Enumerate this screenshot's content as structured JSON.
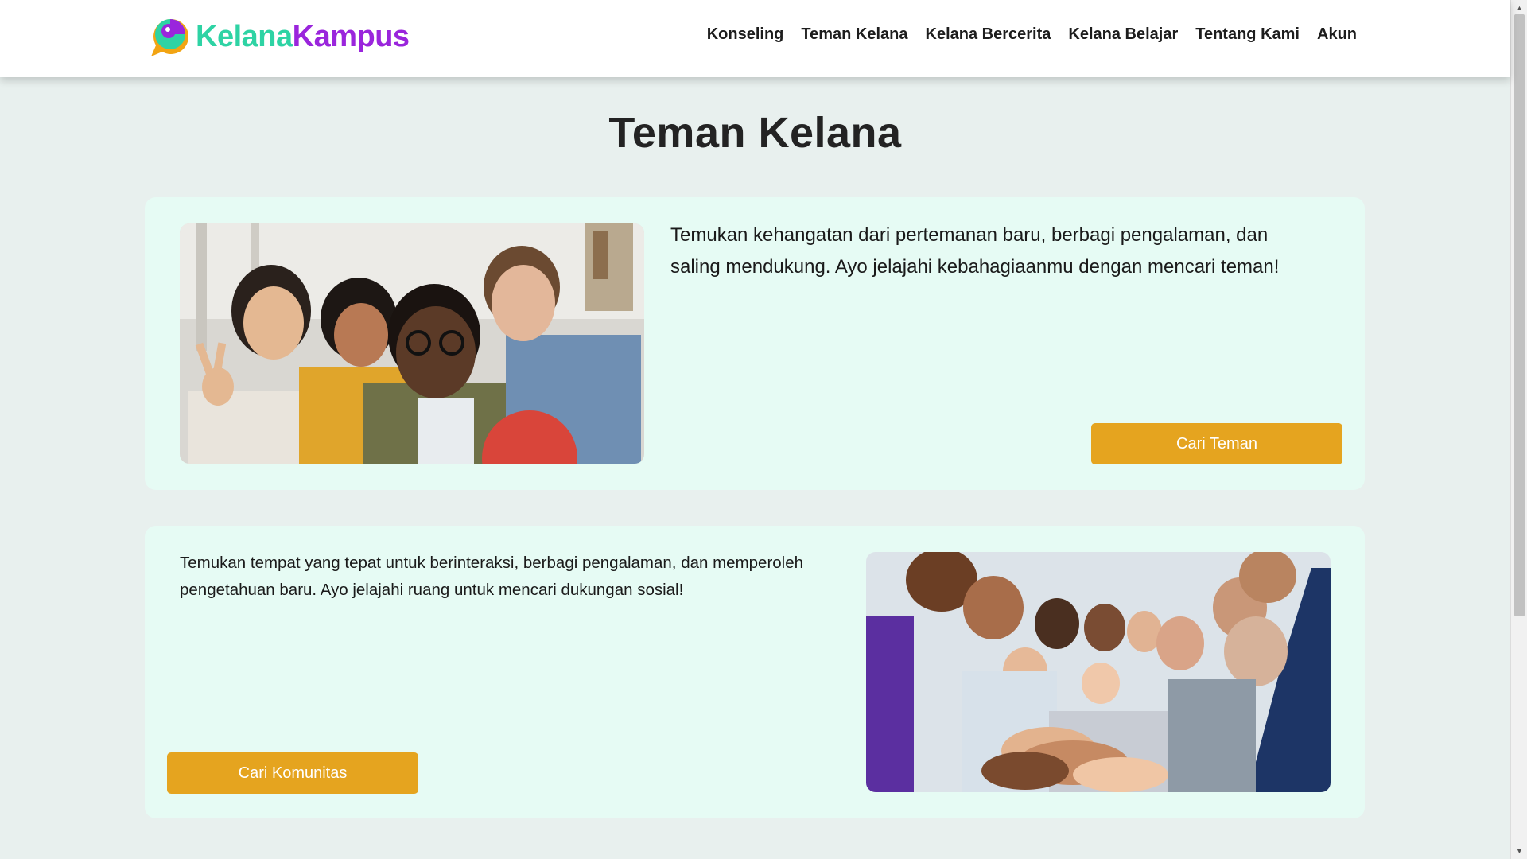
{
  "brand": {
    "name_part1": "Kelana",
    "name_part2": "Kampus",
    "logo_icon": "chat-bubble-logo-icon"
  },
  "nav": {
    "items": [
      {
        "label": "Konseling"
      },
      {
        "label": "Teman Kelana"
      },
      {
        "label": "Kelana Bercerita"
      },
      {
        "label": "Kelana Belajar"
      },
      {
        "label": "Tentang Kami"
      },
      {
        "label": "Akun"
      }
    ]
  },
  "page": {
    "title": "Teman Kelana"
  },
  "cards": [
    {
      "text": "Temukan kehangatan dari pertemanan baru, berbagi pengalaman, dan saling mendukung. Ayo jelajahi kebahagiaanmu dengan mencari teman!",
      "button_label": "Cari Teman",
      "image": "friends-selfie-photo"
    },
    {
      "text": "Temukan tempat yang tepat untuk berinteraksi, berbagi pengalaman, dan memperoleh pengetahuan baru. Ayo jelajahi ruang untuk mencari dukungan sosial!",
      "button_label": "Cari Komunitas",
      "image": "community-group-hands-photo"
    }
  ],
  "colors": {
    "accent_button": "#e5a41f",
    "brand_green": "#2ed3a4",
    "brand_purple": "#9a25dc",
    "card_bg": "#e6fbf4",
    "page_bg": "#e8f0ee"
  }
}
